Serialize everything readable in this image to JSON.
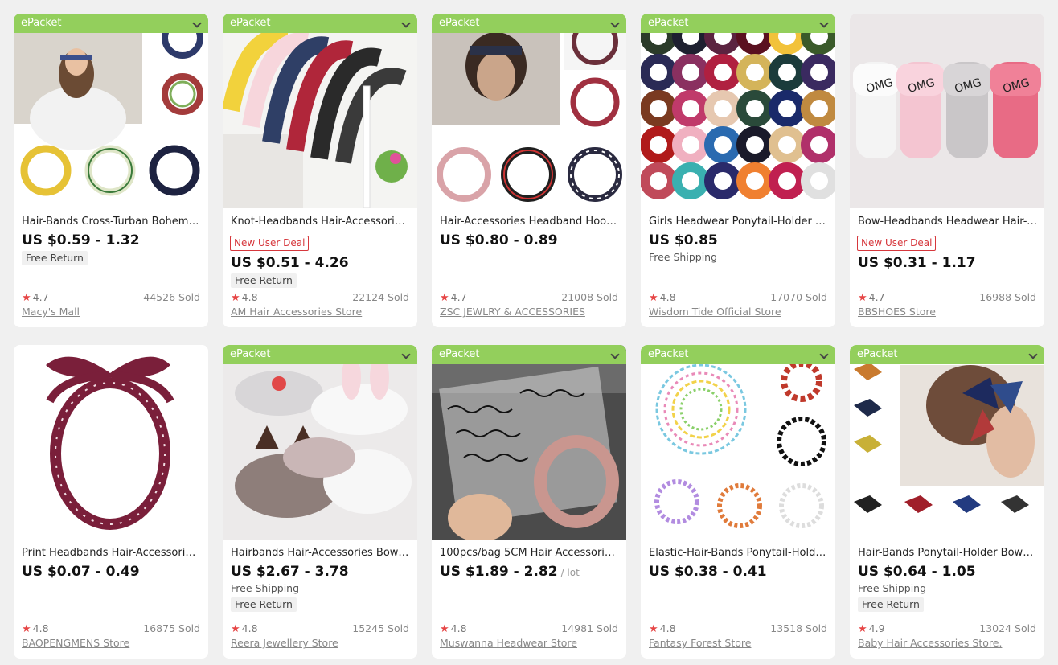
{
  "products": [
    {
      "badge": "ePacket",
      "title": "Hair-Bands Cross-Turban Bohemian...",
      "price": "US $0.59 - 1.32",
      "deal": "",
      "shipping": "",
      "free_return": "Free Return",
      "rating": "4.7",
      "sold": "44526 Sold",
      "store": "Macy's Mall"
    },
    {
      "badge": "ePacket",
      "title": "Knot-Headbands Hair-Accessories ...",
      "price": "US $0.51 - 4.26",
      "deal": "New User Deal",
      "shipping": "",
      "free_return": "Free Return",
      "rating": "4.8",
      "sold": "22124 Sold",
      "store": "AM Hair Accessories Store"
    },
    {
      "badge": "ePacket",
      "title": "Hair-Accessories Headband Hoop ...",
      "price": "US $0.80 - 0.89",
      "deal": "",
      "shipping": "",
      "free_return": "",
      "rating": "4.7",
      "sold": "21008 Sold",
      "store": "ZSC JEWLRY & ACCESSORIES"
    },
    {
      "badge": "ePacket",
      "title": "Girls Headwear Ponytail-Holder Ha...",
      "price": "US $0.85",
      "deal": "",
      "shipping": "Free Shipping",
      "free_return": "",
      "rating": "4.8",
      "sold": "17070 Sold",
      "store": "Wisdom Tide Official Store"
    },
    {
      "badge": "",
      "title": "Bow-Headbands Headwear Hair-A...",
      "price": "US $0.31 - 1.17",
      "deal": "New User Deal",
      "shipping": "",
      "free_return": "",
      "rating": "4.7",
      "sold": "16988 Sold",
      "store": "BBSHOES Store"
    },
    {
      "badge": "",
      "title": "Print Headbands Hair-Accessories ...",
      "price": "US $0.07 - 0.49",
      "deal": "",
      "shipping": "",
      "free_return": "",
      "rating": "4.8",
      "sold": "16875 Sold",
      "store": "BAOPENGMENS Store"
    },
    {
      "badge": "ePacket",
      "title": "Hairbands Hair-Accessories Bow F...",
      "price": "US $2.67 - 3.78",
      "deal": "",
      "shipping": "Free Shipping",
      "free_return": "Free Return",
      "rating": "4.8",
      "sold": "15245 Sold",
      "store": "Reera Jewellery Store"
    },
    {
      "badge": "ePacket",
      "title": "100pcs/bag 5CM Hair Accessories ...",
      "price": "US $1.89 - 2.82",
      "price_unit": "/ lot",
      "deal": "",
      "shipping": "",
      "free_return": "",
      "rating": "4.8",
      "sold": "14981 Sold",
      "store": "Muswanna Headwear Store"
    },
    {
      "badge": "ePacket",
      "title": "Elastic-Hair-Bands Ponytail-Holder ...",
      "price": "US $0.38 - 0.41",
      "deal": "",
      "shipping": "",
      "free_return": "",
      "rating": "4.8",
      "sold": "13518 Sold",
      "store": "Fantasy Forest Store"
    },
    {
      "badge": "ePacket",
      "title": "Hair-Bands Ponytail-Holder Bowkn...",
      "price": "US $0.64 - 1.05",
      "deal": "",
      "shipping": "Free Shipping",
      "free_return": "Free Return",
      "rating": "4.9",
      "sold": "13024 Sold",
      "store": "Baby Hair Accessories Store."
    }
  ],
  "icons": {
    "star": "star-icon",
    "chevron": "chevron-down-icon"
  },
  "colors": {
    "badge_bg": "#93cf5c",
    "deal": "#d6373c",
    "star": "#e64545",
    "page_bg": "#f0f0f0"
  }
}
